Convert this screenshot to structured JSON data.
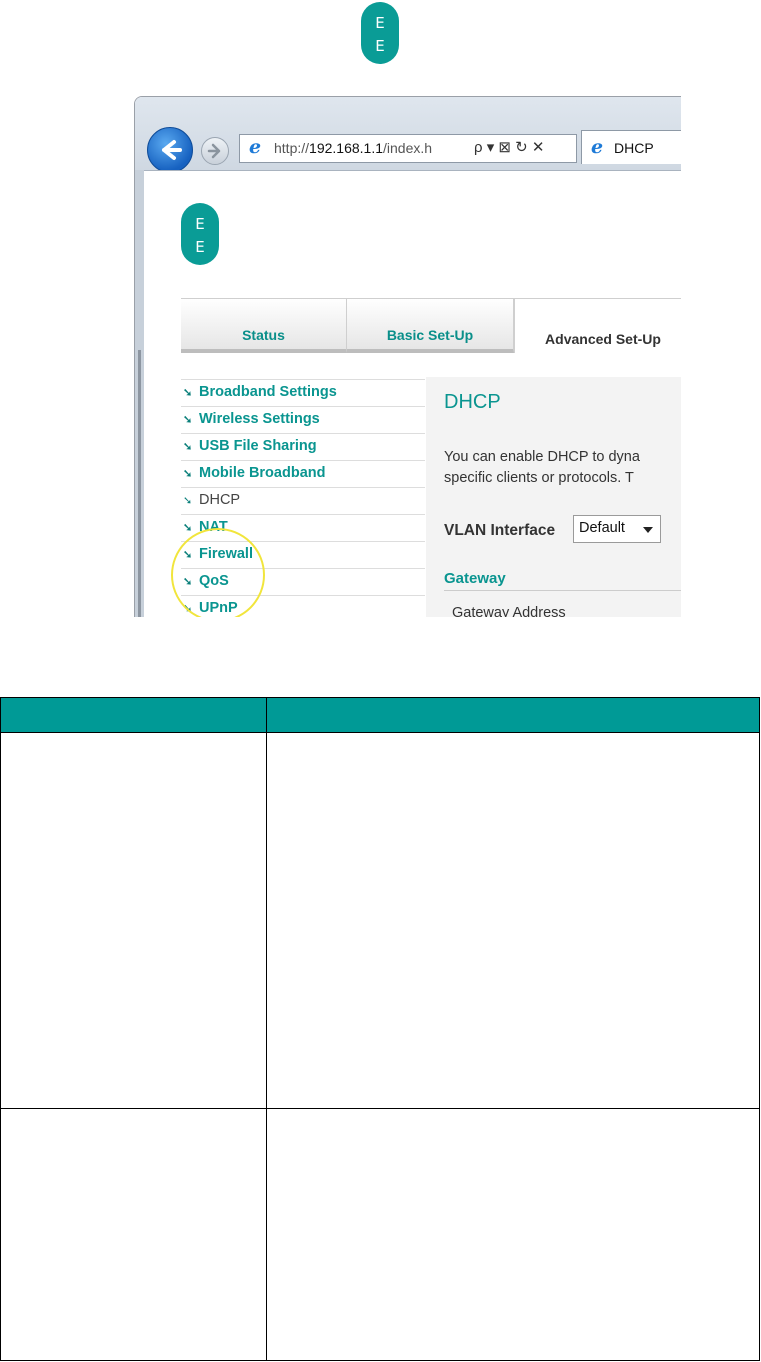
{
  "top_logo": {
    "letters": [
      "E",
      "E"
    ]
  },
  "browser": {
    "address": {
      "prefix": "http://",
      "host": "192.168.1.1",
      "path": "/index.h",
      "tools": "ρ ▾ ⊠ ↻ ✕"
    },
    "tab_title": "DHCP"
  },
  "router_page": {
    "logo_letters": [
      "E",
      "E"
    ],
    "tabs": [
      {
        "label": "Status",
        "active": false
      },
      {
        "label": "Basic Set-Up",
        "active": false
      },
      {
        "label": "Advanced Set-Up",
        "active": true
      }
    ],
    "menu_items": [
      "Broadband Settings",
      "Wireless Settings",
      "USB File Sharing",
      "Mobile Broadband",
      "DHCP",
      "NAT",
      "Firewall",
      "QoS",
      "UPnP"
    ],
    "menu_arrow": "➘",
    "content": {
      "title": "DHCP",
      "description_lines": [
        "You can enable DHCP to dyna",
        "specific clients or protocols. T"
      ],
      "vlan_label": "VLAN Interface",
      "vlan_value": "Default",
      "gateway_heading": "Gateway",
      "gateway_address_label": "Gateway Address"
    }
  },
  "colors": {
    "brand_teal": "#009a96",
    "highlight_ring": "#f1e53c"
  }
}
